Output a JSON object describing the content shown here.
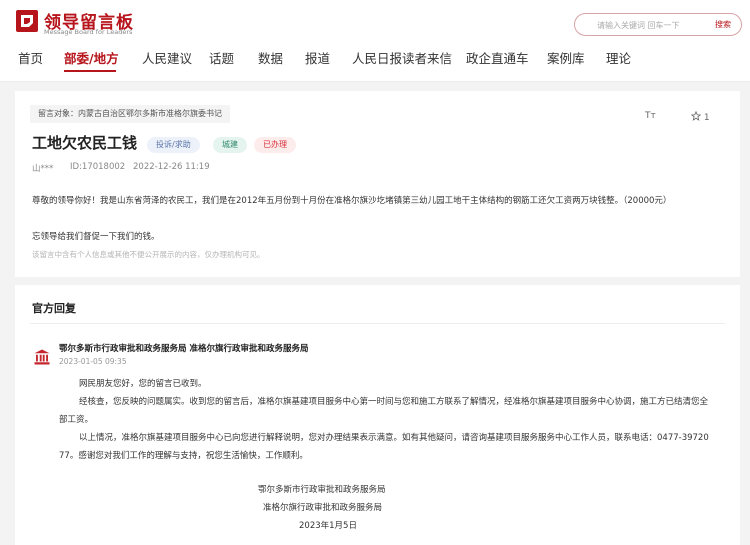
{
  "brand": {
    "name": "领导留言板",
    "subtitle": "Message Board for Leaders",
    "color": "#b7151c"
  },
  "search": {
    "placeholder": "请输入关键词 回车一下",
    "button_label": "搜索"
  },
  "nav": {
    "items": [
      {
        "label": "首页"
      },
      {
        "label": "部委/地方"
      },
      {
        "label": "人民建议"
      },
      {
        "label": "话题"
      },
      {
        "label": "数据"
      },
      {
        "label": "报道"
      },
      {
        "label": "人民日报读者来信"
      },
      {
        "label": "政企直通车"
      },
      {
        "label": "案例库"
      },
      {
        "label": "理论"
      }
    ],
    "active_index": 1
  },
  "message": {
    "target": "留言对象：内蒙古自治区鄂尔多斯市准格尔旗委书记",
    "font_action": "Tт",
    "like_count": "1",
    "title": "工地欠农民工钱",
    "category": "投诉/求助",
    "field": "城建",
    "status": "已办理",
    "author": "山***",
    "id": "ID:17018002",
    "time": "2022-12-26 11:19",
    "body": [
      "尊敬的领导你好！我是山东省菏泽的农民工，我们是在2012年五月份到十月份在准格尔旗沙圪堵镇第三幼儿园工地干主体结构的钢筋工还欠工资两万块钱整。（20000元）",
      "忘领导给我们督促一下我们的钱。"
    ],
    "privacy_note": "该留言中含有个人信息或其他不便公开展示的内容，仅办理机构可见。"
  },
  "reply": {
    "heading": "官方回复",
    "org": "鄂尔多斯市行政审批和政务服务局 准格尔旗行政审批和政务服务局",
    "time": "2023-01-05 09:35",
    "lines": [
      "网民朋友您好，您的留言已收到。",
      "经核查，您反映的问题属实。收到您的留言后，准格尔旗基建项目服务中心第一时间与您和施工方联系了解情况，经准格尔旗基建项目服务中心协调，施工方已结清您全",
      "部工资。",
      "以上情况，准格尔旗基建项目服务中心已向您进行解释说明，您对办理结果表示满意。如有其他疑问，请咨询基建项目服务服务中心工作人员，联系电话：0477-39720",
      "77。感谢您对我们工作的理解与支持，祝您生活愉快，工作顺利。"
    ],
    "sign_org_1": "鄂尔多斯市行政审批和政务服务局",
    "sign_org_2": "准格尔旗行政审批和政务服务局",
    "sign_date": "2023年1月5日"
  }
}
